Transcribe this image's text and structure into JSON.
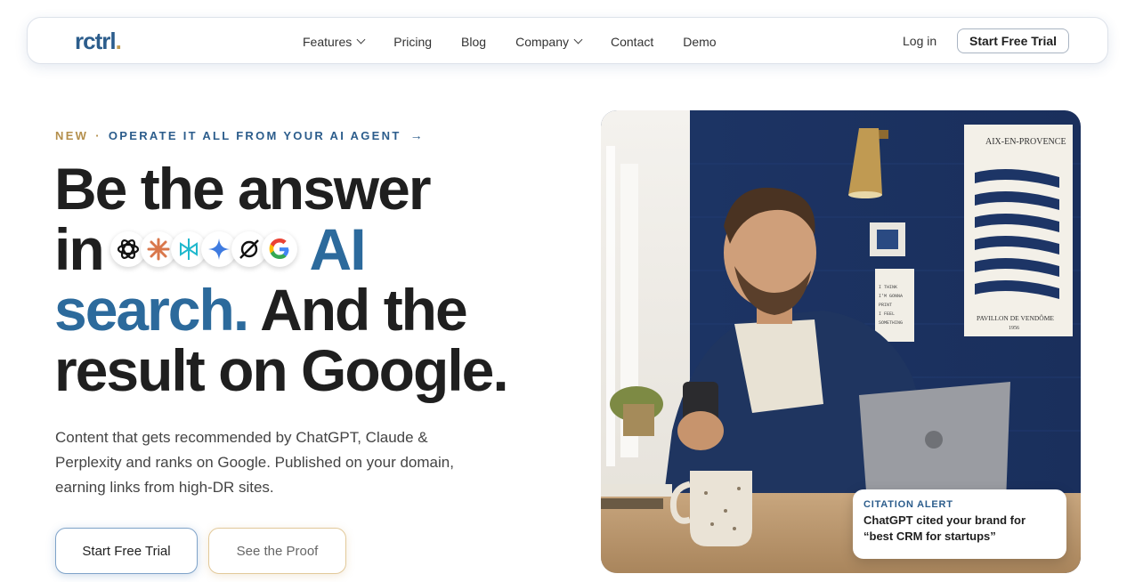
{
  "brand": {
    "logo_text": "rctrl",
    "logo_dot": "."
  },
  "nav": {
    "links": [
      {
        "label": "Features",
        "has_dropdown": true
      },
      {
        "label": "Pricing",
        "has_dropdown": false
      },
      {
        "label": "Blog",
        "has_dropdown": false
      },
      {
        "label": "Company",
        "has_dropdown": true
      },
      {
        "label": "Contact",
        "has_dropdown": false
      },
      {
        "label": "Demo",
        "has_dropdown": false
      }
    ],
    "login_label": "Log in",
    "cta_label": "Start Free Trial"
  },
  "hero": {
    "eyebrow_new": "NEW",
    "eyebrow_sep": "·",
    "eyebrow_text": "OPERATE IT ALL FROM YOUR AI AGENT",
    "eyebrow_arrow": "→",
    "headline_line1": "Be the answer",
    "headline_in": "in",
    "headline_ai": "AI",
    "headline_search": "search.",
    "headline_and": "And the",
    "headline_line4": "result on Google.",
    "ai_logos": [
      "openai-icon",
      "claude-icon",
      "perplexity-icon",
      "gemini-icon",
      "grok-icon",
      "google-icon"
    ],
    "subtext": "Content that gets recommended by ChatGPT, Claude & Perplexity and ranks on Google. Published on your domain, earning links from high-DR sites.",
    "primary_button": "Start Free Trial",
    "secondary_button": "See the Proof"
  },
  "image": {
    "poster_title": "AIX-EN-PROVENCE",
    "poster_footer": "PAVILLON DE VENDÔME",
    "poster_year": "1956",
    "note_text": "I THINK / I'M GONNA / PRINT / I FEEL / SOMETHING"
  },
  "alert": {
    "label": "CITATION ALERT",
    "text": "ChatGPT cited your brand for “best CRM for startups”"
  },
  "colors": {
    "brand_blue": "#2c6a9c",
    "brand_gold": "#b48f4c",
    "text_dark": "#1f1f1f"
  }
}
